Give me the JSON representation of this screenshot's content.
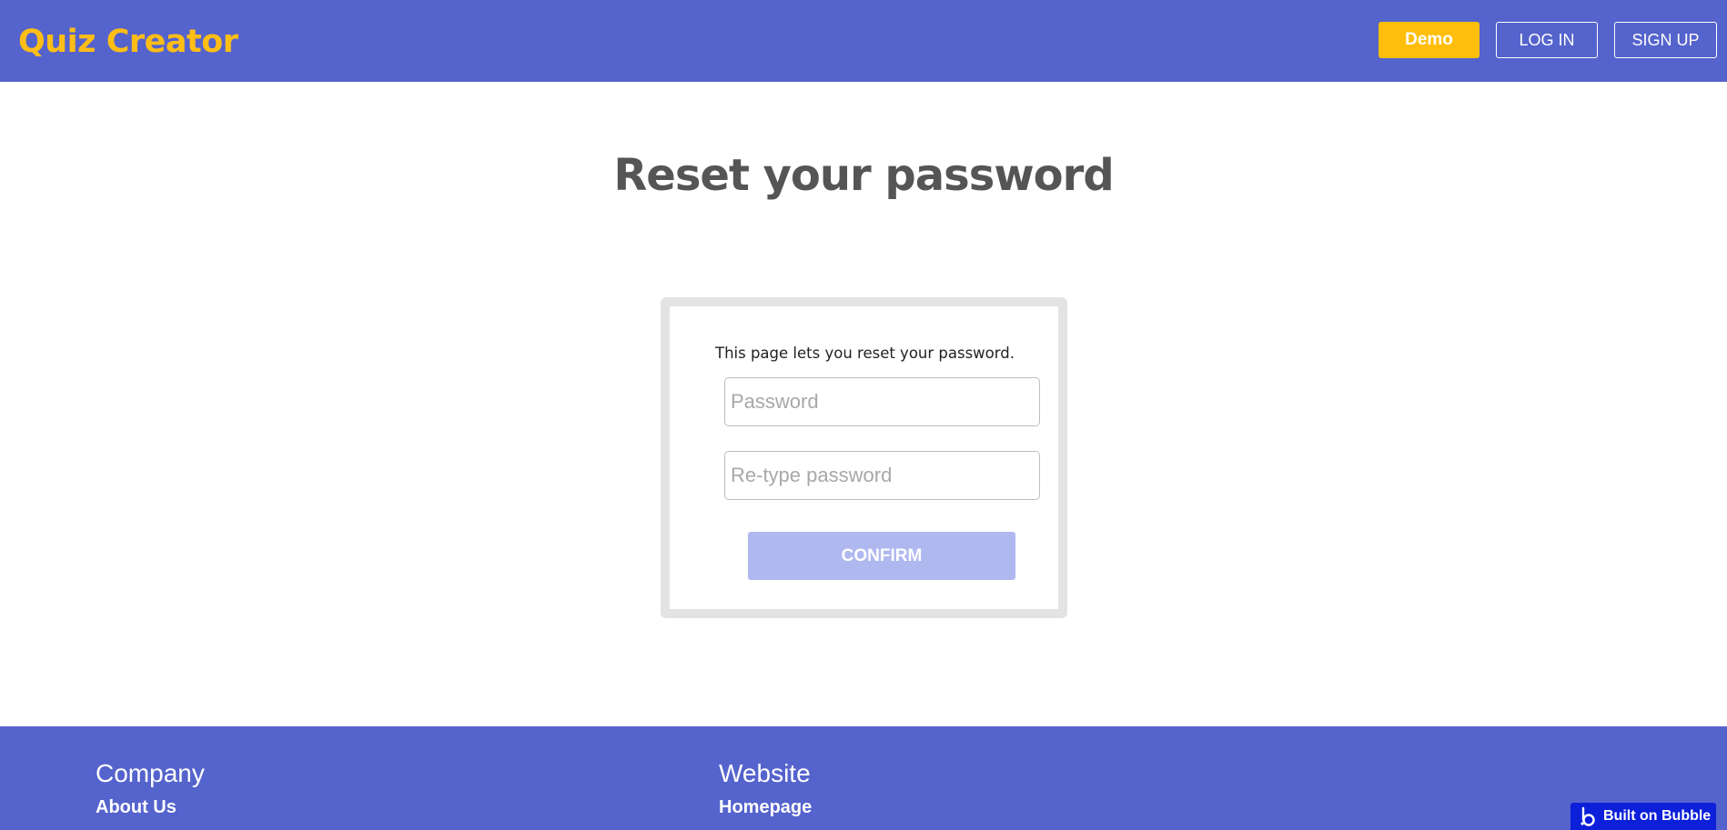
{
  "header": {
    "brand": "Quiz Creator",
    "demo_label": "Demo",
    "login_label": "LOG IN",
    "signup_label": "SIGN UP"
  },
  "main": {
    "title": "Reset your password",
    "card": {
      "description": "This page lets you reset your password.",
      "password_placeholder": "Password",
      "password_value": "",
      "retype_placeholder": "Re-type password",
      "retype_value": "",
      "confirm_label": "CONFIRM"
    }
  },
  "footer": {
    "company_heading": "Company",
    "company_link": "About Us",
    "website_heading": "Website",
    "website_link": "Homepage"
  },
  "badge": {
    "label": "Built on Bubble",
    "icon": "bubble-logo-icon"
  },
  "colors": {
    "primary": "#5563cc",
    "brand_text": "#ffbe16",
    "demo_button": "#ffbe0b",
    "confirm_disabled": "#b0b8f0",
    "badge": "#0c1fd9"
  }
}
